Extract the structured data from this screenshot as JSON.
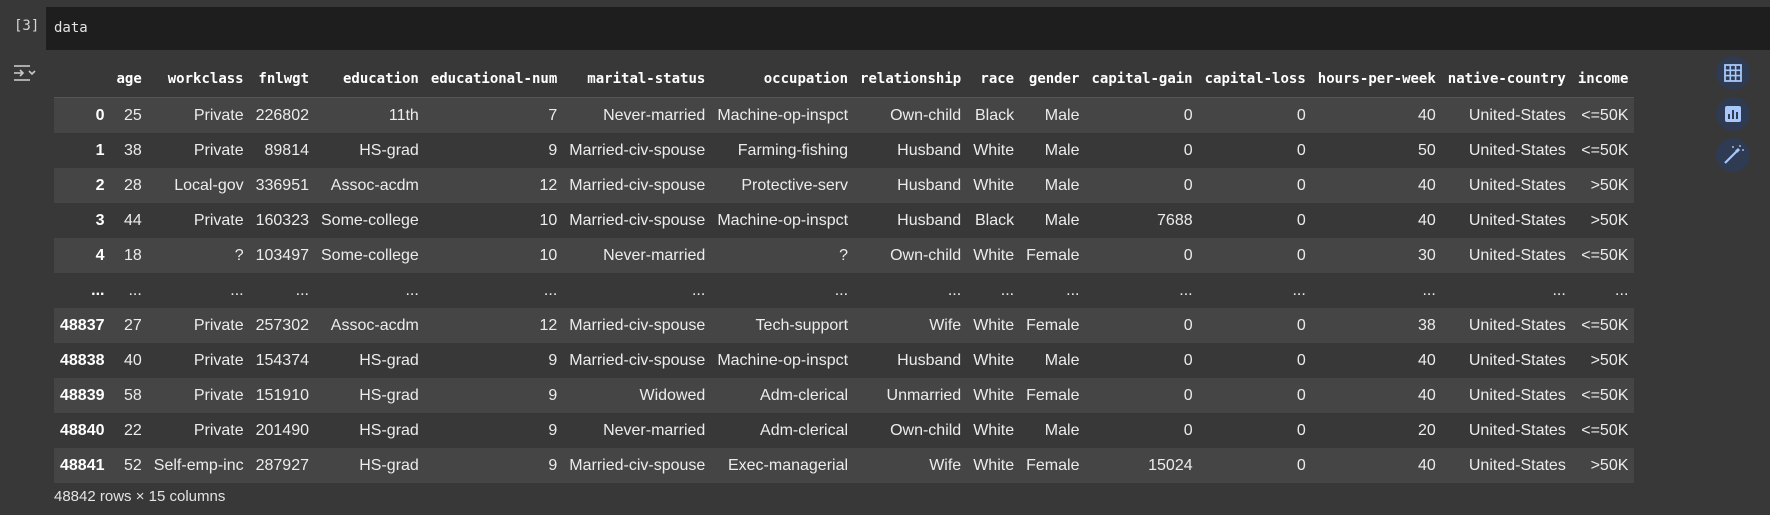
{
  "cell": {
    "exec_count": "[3]",
    "code": "data"
  },
  "output": {
    "toggle_icon": "output-collapse-icon",
    "columns": [
      "",
      "age",
      "workclass",
      "fnlwgt",
      "education",
      "educational-num",
      "marital-status",
      "occupation",
      "relationship",
      "race",
      "gender",
      "capital-gain",
      "capital-loss",
      "hours-per-week",
      "native-country",
      "income"
    ],
    "rows": [
      [
        "0",
        "25",
        "Private",
        "226802",
        "11th",
        "7",
        "Never-married",
        "Machine-op-inspct",
        "Own-child",
        "Black",
        "Male",
        "0",
        "0",
        "40",
        "United-States",
        "<=50K"
      ],
      [
        "1",
        "38",
        "Private",
        "89814",
        "HS-grad",
        "9",
        "Married-civ-spouse",
        "Farming-fishing",
        "Husband",
        "White",
        "Male",
        "0",
        "0",
        "50",
        "United-States",
        "<=50K"
      ],
      [
        "2",
        "28",
        "Local-gov",
        "336951",
        "Assoc-acdm",
        "12",
        "Married-civ-spouse",
        "Protective-serv",
        "Husband",
        "White",
        "Male",
        "0",
        "0",
        "40",
        "United-States",
        ">50K"
      ],
      [
        "3",
        "44",
        "Private",
        "160323",
        "Some-college",
        "10",
        "Married-civ-spouse",
        "Machine-op-inspct",
        "Husband",
        "Black",
        "Male",
        "7688",
        "0",
        "40",
        "United-States",
        ">50K"
      ],
      [
        "4",
        "18",
        "?",
        "103497",
        "Some-college",
        "10",
        "Never-married",
        "?",
        "Own-child",
        "White",
        "Female",
        "0",
        "0",
        "30",
        "United-States",
        "<=50K"
      ],
      [
        "...",
        "...",
        "...",
        "...",
        "...",
        "...",
        "...",
        "...",
        "...",
        "...",
        "...",
        "...",
        "...",
        "...",
        "...",
        "..."
      ],
      [
        "48837",
        "27",
        "Private",
        "257302",
        "Assoc-acdm",
        "12",
        "Married-civ-spouse",
        "Tech-support",
        "Wife",
        "White",
        "Female",
        "0",
        "0",
        "38",
        "United-States",
        "<=50K"
      ],
      [
        "48838",
        "40",
        "Private",
        "154374",
        "HS-grad",
        "9",
        "Married-civ-spouse",
        "Machine-op-inspct",
        "Husband",
        "White",
        "Male",
        "0",
        "0",
        "40",
        "United-States",
        ">50K"
      ],
      [
        "48839",
        "58",
        "Private",
        "151910",
        "HS-grad",
        "9",
        "Widowed",
        "Adm-clerical",
        "Unmarried",
        "White",
        "Female",
        "0",
        "0",
        "40",
        "United-States",
        "<=50K"
      ],
      [
        "48840",
        "22",
        "Private",
        "201490",
        "HS-grad",
        "9",
        "Never-married",
        "Adm-clerical",
        "Own-child",
        "White",
        "Male",
        "0",
        "0",
        "20",
        "United-States",
        "<=50K"
      ],
      [
        "48841",
        "52",
        "Self-emp-inc",
        "287927",
        "HS-grad",
        "9",
        "Married-civ-spouse",
        "Exec-managerial",
        "Wife",
        "White",
        "Female",
        "15024",
        "0",
        "40",
        "United-States",
        ">50K"
      ]
    ],
    "footer": "48842 rows × 15 columns"
  },
  "side_tools": [
    {
      "icon": "table-icon"
    },
    {
      "icon": "chart-icon"
    },
    {
      "icon": "magic-wand-icon"
    }
  ],
  "colors": {
    "background": "#383838",
    "editor_bg": "#1e1e1e",
    "row_stripe": "#454545",
    "tool_button": "#2f3b52",
    "tool_icon": "#a8c7fa"
  }
}
